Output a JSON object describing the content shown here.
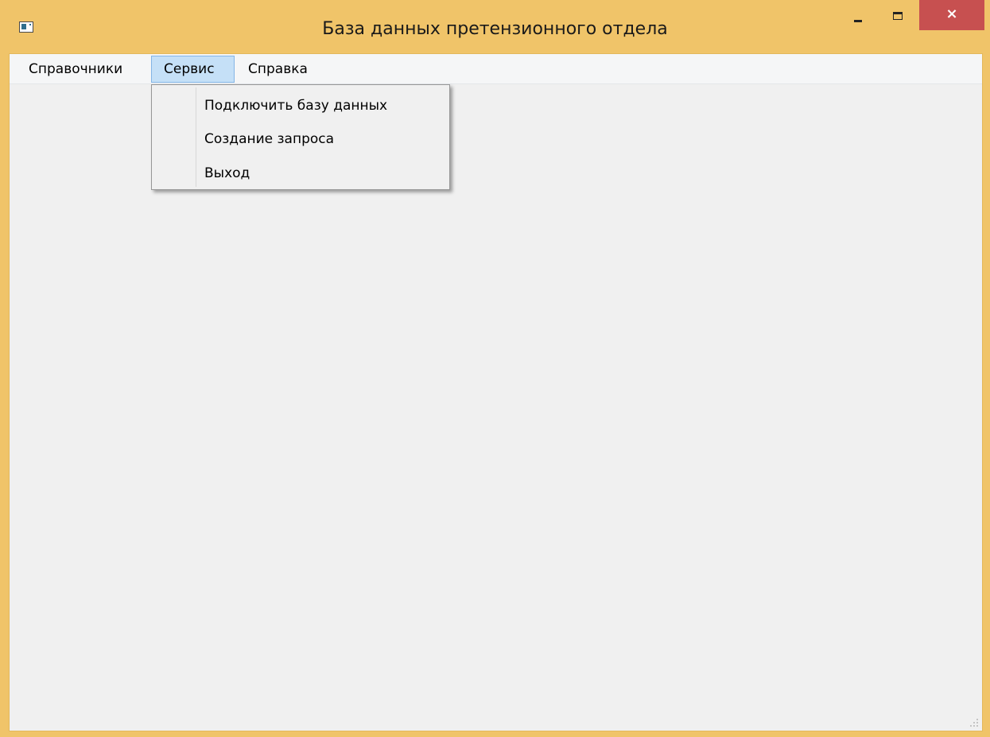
{
  "window": {
    "title": "База данных претензионного отдела",
    "app_icon": "app-window-icon",
    "controls": {
      "minimize_icon": "minimize-icon",
      "maximize_icon": "maximize-icon",
      "close_label": "×"
    },
    "colors": {
      "frame": "#f0c469",
      "close_button": "#c75050",
      "menu_highlight": "#c5e0f7"
    }
  },
  "menubar": {
    "items": [
      {
        "label": "Справочники"
      },
      {
        "label": "Сервис"
      },
      {
        "label": "Справка"
      }
    ]
  },
  "service_menu": {
    "items": [
      {
        "label": "Подключить базу данных"
      },
      {
        "label": "Создание запроса"
      },
      {
        "label": "Выход"
      }
    ]
  }
}
